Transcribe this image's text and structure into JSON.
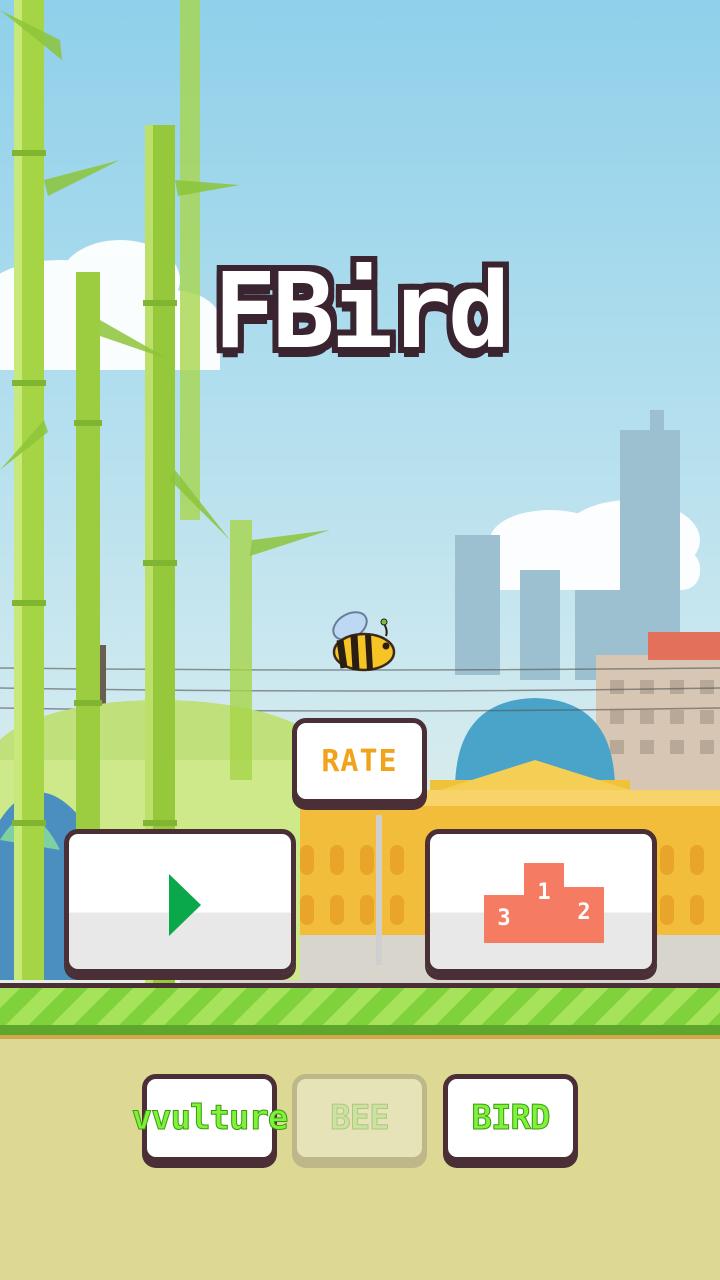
{
  "game": {
    "title": "FBird",
    "rate_label": "RATE",
    "play_icon": "play-triangle-icon",
    "leaderboard_icon": "podium-icon",
    "podium_labels": [
      "1",
      "2",
      "3"
    ],
    "characters": [
      {
        "label": "vvulture",
        "selected": false
      },
      {
        "label": "BEE",
        "selected": true
      },
      {
        "label": "BIRD",
        "selected": false
      }
    ]
  },
  "colors": {
    "outline": "#4a2f36",
    "rate_text": "#f2a31c",
    "play_icon": "#0aa84a",
    "podium": "#f57b63",
    "character_text": "#7ff23a",
    "ground_stripe": "#7fd23c",
    "ground": "#ded895"
  }
}
